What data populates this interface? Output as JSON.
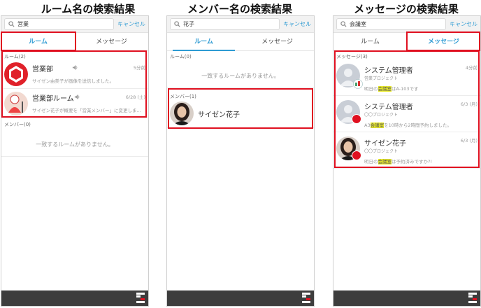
{
  "panels": {
    "room": {
      "title": "ルーム名の検索結果",
      "search_value": "営業",
      "cancel_label": "キャンセル",
      "tabs": [
        "ルーム",
        "メッセージ"
      ],
      "active_tab": 0,
      "rooms_section": "ルーム(2)",
      "rooms": [
        {
          "name": "営業部",
          "time": "5分前",
          "preview": "サイゼン由美子が画像を送信しました。"
        },
        {
          "name": "営業部ルーム",
          "time": "6/28 (土)",
          "preview": "サイゼン花子が概要を「営業メンバー」に変更しま..."
        }
      ],
      "members_section": "メンバー(0)",
      "members_empty": "一致するルームがありません。"
    },
    "member": {
      "title": "メンバー名の検索結果",
      "search_value": "花子",
      "cancel_label": "キャンセル",
      "tabs": [
        "ルーム",
        "メッセージ"
      ],
      "active_tab": 0,
      "rooms_section": "ルーム(0)",
      "rooms_empty": "一致するルームがありません。",
      "members_section": "メンバー(1)",
      "members": [
        {
          "name": "サイゼン花子"
        }
      ]
    },
    "message": {
      "title": "メッセージの検索結果",
      "search_value": "会議室",
      "cancel_label": "キャンセル",
      "tabs": [
        "ルーム",
        "メッセージ"
      ],
      "active_tab": 1,
      "messages_section": "メッセージ(3)",
      "messages": [
        {
          "name": "システム管理者",
          "sub": "営業プロジェクト",
          "time": "4分前",
          "pre": "明日の",
          "hit": "会議室",
          "post": "はA-103です"
        },
        {
          "name": "システム管理者",
          "sub": "〇〇プロジェクト",
          "time": "6/3 (月)",
          "pre": "A3",
          "hit": "会議室",
          "post": "を10時から2時間予約しました。"
        },
        {
          "name": "サイゼン花子",
          "sub": "〇〇プロジェクト",
          "time": "6/3 (月)",
          "pre": "明日の",
          "hit": "会議室",
          "post": "は予約済みですか?!"
        }
      ]
    }
  },
  "colors": {
    "accent": "#2e9bd3",
    "highlight_box": "#e01020",
    "keyword_highlight": "#e9ea2b",
    "footer": "#3d3d3d"
  }
}
